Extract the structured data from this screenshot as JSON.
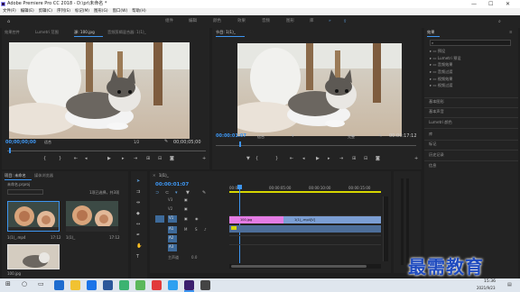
{
  "window": {
    "title": "Adobe Premiere Pro CC 2018 - D:\\pr\\未命名 *",
    "controls": [
      "—",
      "☐",
      "✕"
    ]
  },
  "menu": [
    "文件(F)",
    "编辑(E)",
    "剪辑(C)",
    "序列(S)",
    "标记(M)",
    "图形(G)",
    "窗口(W)",
    "帮助(H)"
  ],
  "workspaces": {
    "items": [
      "组件",
      "编辑",
      "颜色",
      "效果",
      "音频",
      "图形",
      "库"
    ],
    "more": "»"
  },
  "source": {
    "tabs": [
      "效果控件",
      "Lumetri 范围",
      "源: 100.jpg",
      "音频剪辑混合器: 1(1)_"
    ],
    "timecode": "00;00;00;00",
    "fit": "适合",
    "fraction": "1/2",
    "duration": "00;00;05;00"
  },
  "program": {
    "tab": "节目: 1(1)_",
    "timecode": "00:00:01:07",
    "fit": "适合",
    "quality": "完整",
    "duration": "00:00:17:12"
  },
  "effects": {
    "tab": "效果",
    "items": [
      "预设",
      "Lumetri 预设",
      "音频效果",
      "音频过渡",
      "视频效果",
      "视频过渡"
    ],
    "panels": [
      "基本图形",
      "基本声音",
      "Lumetri 颜色",
      "库",
      "标记",
      "历史记录",
      "信息"
    ]
  },
  "project": {
    "tabs": [
      "项目: 未命名",
      "媒体浏览器"
    ],
    "filename": "未命名.prproj",
    "count": "1项已选择，共3项",
    "bins": [
      {
        "name": "1(1)_.mp4",
        "dur": "17:12"
      },
      {
        "name": "1(1)_",
        "dur": "17:12"
      },
      {
        "name": "100.jpg",
        "dur": ""
      }
    ]
  },
  "timeline": {
    "tab": "1(1)_",
    "timecode": "00:00:01:07",
    "ruler": [
      "00:00",
      "00:00:05:00",
      "00:00:10:00",
      "00:00:15:00"
    ],
    "tracks": {
      "video": [
        "V3",
        "V2",
        "V1"
      ],
      "audio": [
        "A1",
        "A2",
        "A3"
      ]
    },
    "master": "主声道",
    "master_val": "0.0",
    "clip_image": "100.jpg",
    "clip_video": "1(1)_.mp4[V]"
  },
  "watermark": "最需教育",
  "clock": {
    "time": "15:36",
    "date": "2021/9/23"
  },
  "colors": {
    "accent": "#3d95f0",
    "clip_pink": "#e47ce4",
    "clip_blue": "#6e93c8"
  }
}
